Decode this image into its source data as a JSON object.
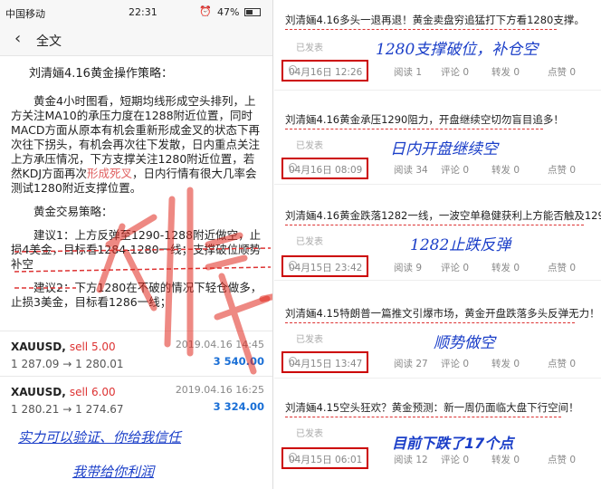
{
  "status_bar": {
    "carrier": "中国移动",
    "time": "22:31",
    "battery": "47%"
  },
  "nav": {
    "back_icon": "‹",
    "title": "全文"
  },
  "article": {
    "heading": "刘清婳4.16黄金操作策略：",
    "para1_a": "黄金4小时图看，短期均线形成空头排列，上方关注MA10的承压力度在1288附近位置，同时MACD方面从原本有机会重新形成金叉的状态下再次往下拐头，有机会再次往下发散，日内重点关注上方承压情况，下方支撑关注1280附近位置，若然KDJ方面再次",
    "para1_hl": "形成死叉",
    "para1_b": "，日内行情有很大几率会测试1280附近支撑位置。",
    "strategy_label": "黄金交易策略：",
    "sugg1": "建议1：上方反弹至1290-1288附近做空，止损4美金，目标看1284-1280一线；支撑破位顺势补空",
    "sugg2": "建议2：下方1280在不破的情况下轻仓做多，止损3美金，目标看1286一线；"
  },
  "trades": [
    {
      "symbol": "XAUUSD,",
      "side": "sell 5.00",
      "prices": "1 287.09 → 1 280.01",
      "date": "2019.04.16 14:45",
      "profit": "3 540.00"
    },
    {
      "symbol": "XAUUSD,",
      "side": "sell 6.00",
      "prices": "1 280.21 → 1 274.67",
      "date": "2019.04.16 16:25",
      "profit": "3 324.00"
    }
  ],
  "left_overlay": {
    "line1": "实力可以验证、你给我信任",
    "line2": "我带给你利润"
  },
  "posts": [
    {
      "title": "刘清婳4.16多头一退再退！黄金卖盘穷追猛打下方看1280支撑。",
      "status": "已发表",
      "timestamp": "04月16日 12:26",
      "reads": "阅读 1",
      "comments": "评论 0",
      "shares": "转发 0",
      "likes": "点赞 0",
      "overlay": "1280支撑破位，补仓空"
    },
    {
      "title": "刘清婳4.16黄金承压1290阻力，开盘继续空切勿盲目追多！",
      "status": "已发表",
      "timestamp": "04月16日 08:09",
      "reads": "阅读 34",
      "comments": "评论 0",
      "shares": "转发 0",
      "likes": "点赞 0",
      "overlay": "日内开盘继续空"
    },
    {
      "title": "刘清婳4.16黄金跌落1282一线，一波空单稳健获利上方能否触及1290？",
      "status": "已发表",
      "timestamp": "04月15日 23:42",
      "reads": "阅读 9",
      "comments": "评论 0",
      "shares": "转发 0",
      "likes": "点赞 0",
      "overlay": "1282止跌反弹"
    },
    {
      "title": "刘清婳4.15特朗普一篇推文引爆市场，黄金开盘跌落多头反弹无力！",
      "status": "已发表",
      "timestamp": "04月15日 13:47",
      "reads": "阅读 27",
      "comments": "评论 0",
      "shares": "转发 0",
      "likes": "点赞 0",
      "overlay": "顺势做空"
    },
    {
      "title": "刘清婳4.15空头狂欢？黄金预测：新一周仍面临大盘下行空间！",
      "status": "已发表",
      "timestamp": "04月15日 06:01",
      "reads": "阅读 12",
      "comments": "评论 0",
      "shares": "转发 0",
      "likes": "点赞 0",
      "overlay": "目前下跌了17个点"
    }
  ],
  "watermark": {
    "text": "刘清婳",
    "color": "#e0281e"
  },
  "colors": {
    "accent_red": "#cc0000",
    "overlay_blue": "#1a3ec8",
    "profit_blue": "#1a6fd6"
  }
}
